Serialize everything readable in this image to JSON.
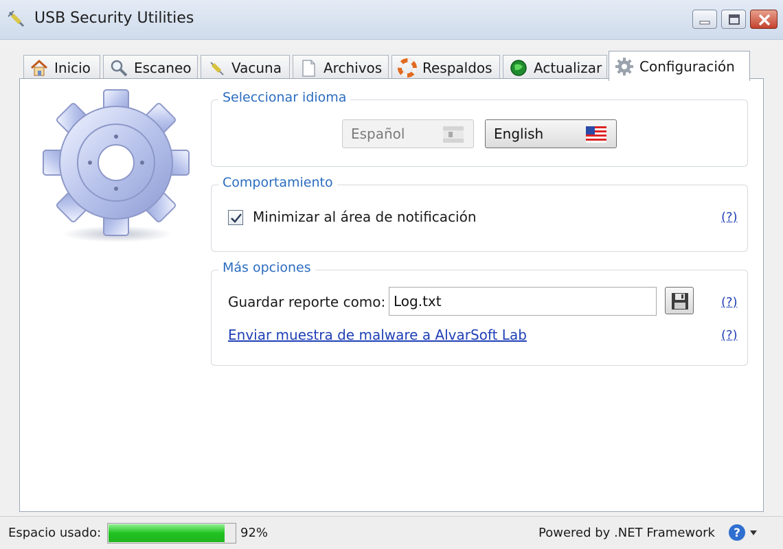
{
  "window": {
    "title": "USB Security Utilities"
  },
  "tabs": [
    {
      "label": "Inicio",
      "icon": "home-icon"
    },
    {
      "label": "Escaneo",
      "icon": "magnifier-icon"
    },
    {
      "label": "Vacuna",
      "icon": "syringe-icon"
    },
    {
      "label": "Archivos",
      "icon": "document-icon"
    },
    {
      "label": "Respaldos",
      "icon": "lifebuoy-icon"
    },
    {
      "label": "Actualizar",
      "icon": "globe-update-icon"
    },
    {
      "label": "Configuración",
      "icon": "gear-icon",
      "active": true
    }
  ],
  "language": {
    "title": "Seleccionar idioma",
    "spanish_label": "Español",
    "english_label": "English",
    "selected": "English"
  },
  "behavior": {
    "title": "Comportamiento",
    "minimize_label": "Minimizar al área de notificación",
    "minimize_checked": true,
    "help": "(?)"
  },
  "more_options": {
    "title": "Más opciones",
    "report_label": "Guardar reporte como:",
    "report_value": "Log.txt",
    "report_help": "(?)",
    "malware_link": "Enviar muestra de malware a AlvarSoft Lab",
    "malware_help": "(?)"
  },
  "status": {
    "space_label": "Espacio usado:",
    "space_percent": 92,
    "space_text": "92%",
    "powered_by": "Powered by .NET Framework"
  }
}
